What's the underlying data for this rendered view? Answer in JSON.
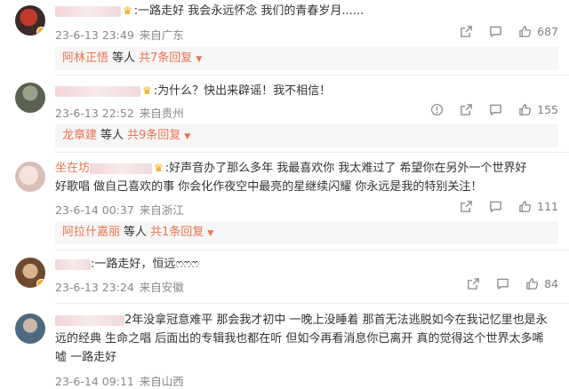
{
  "comments": [
    {
      "name_visible": "",
      "text": ":一路走好 我会永远怀念 我们的青春岁月......",
      "date": "23-6-13 23:49",
      "location": "来自广东",
      "likes": "687",
      "reply": {
        "name": "阿林正悟",
        "mid": "等人",
        "count": "共7条回复"
      }
    },
    {
      "name_visible": "",
      "text": ":为什么？快出来辟谣！我不相信！",
      "date": "23-6-13 22:52",
      "location": "来自贵州",
      "likes": "155",
      "reply": {
        "name": "龙章建",
        "mid": "等人",
        "count": "共9条回复"
      }
    },
    {
      "name_visible": "坐在坊",
      "text_line1": ":好声音办了那么多年 我最喜欢你 我太难过了 希望你在另外一个世界好",
      "text_line2": "好歌唱 做自己喜欢的事 你会化作夜空中最亮的星继续闪耀 你永远是我的特别关注！",
      "date": "23-6-14 00:37",
      "location": "来自浙江",
      "likes": "111",
      "reply": {
        "name": "阿拉什嘉丽",
        "mid": "等人",
        "count": "共1条回复"
      }
    },
    {
      "name_visible": "",
      "text": ":一路走好，恒远ෆෆෆ",
      "date": "23-6-13 23:24",
      "location": "来自安徽",
      "likes": "84"
    },
    {
      "name_visible": "",
      "text_line1": "2年没拿冠意难平 那会我才初中 一晚上没睡着 那首无法逃脱如今在我记忆里也是永",
      "text_line2": "远的经典 生命之唱 后面出的专辑我也都在听 但如今再看消息你已离开 真的觉得这个世界太多唏",
      "text_line3": "嘘 一路走好",
      "date": "23-6-14 09:11",
      "location": "来自山西"
    }
  ],
  "icons": {
    "share": "share-icon",
    "comment": "comment-icon",
    "like": "thumbs-up-icon",
    "report": "report-icon"
  },
  "colors": {
    "username": "#eb7350",
    "meta": "#888888",
    "reply_bg": "#f6f6f6",
    "crown": "#f0a500"
  }
}
